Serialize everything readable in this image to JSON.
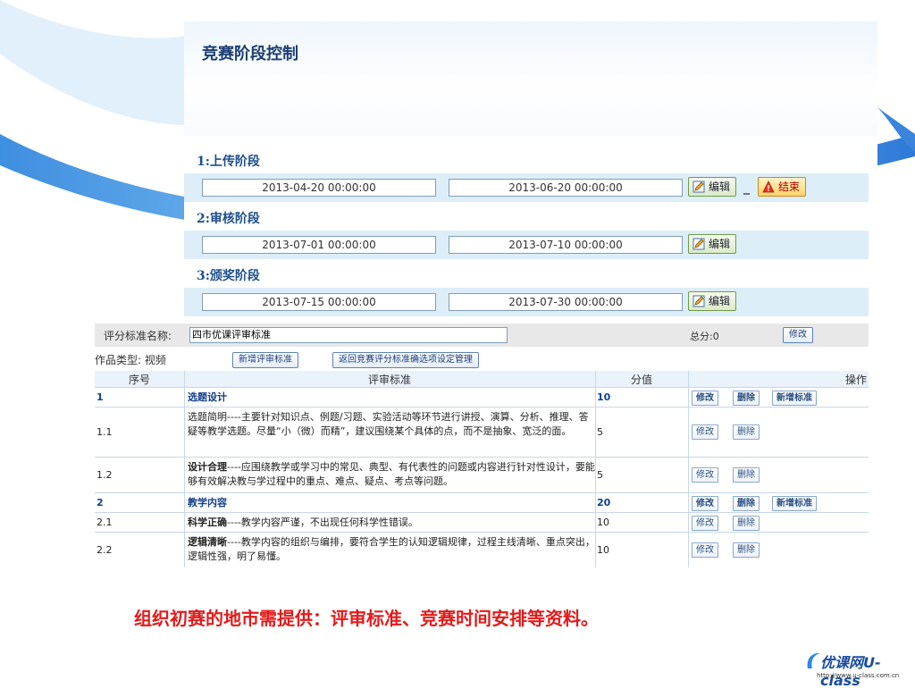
{
  "panel": {
    "title": "竞赛阶段控制",
    "stages": [
      {
        "label": "1:上传阶段",
        "start": "2013-04-20 00:00:00",
        "end": "2013-06-20 00:00:00",
        "edit": "编辑",
        "end_btn": "结束",
        "dash": "_"
      },
      {
        "label": "2:审核阶段",
        "start": "2013-07-01 00:00:00",
        "end": "2013-07-10 00:00:00",
        "edit": "编辑"
      },
      {
        "label": "3:颁奖阶段",
        "start": "2013-07-15 00:00:00",
        "end": "2013-07-30 00:00:00",
        "edit": "编辑"
      }
    ]
  },
  "standard": {
    "name_label": "评分标准名称:",
    "name_value": "四市优课评审标准",
    "total_label": "总分:0",
    "modify_btn": "修改",
    "type_label": "作品类型: 视频",
    "new_btn": "新增评审标准",
    "back_btn": "返回竞赛评分标准确选项设定管理"
  },
  "table": {
    "headers": {
      "no": "序号",
      "std": "评审标准",
      "val": "分值",
      "op": "操作"
    },
    "rows": [
      {
        "no": "1",
        "std_bold": "选题设计",
        "std": "",
        "val": "10",
        "cat": true
      },
      {
        "no": "1.1",
        "std_bold": "",
        "std": "选题简明----主要针对知识点、例题/习题、实验活动等环节进行讲授、演算、分析、推理、答疑等教学选题。尽量“小（微）而精”，建议围绕某个具体的点，而不是抽象、宽泛的面。",
        "val": "5",
        "cat": false
      },
      {
        "no": "1.2",
        "std_bold": "设计合理",
        "std": "----应围绕教学或学习中的常见、典型、有代表性的问题或内容进行针对性设计，要能够有效解决教与学过程中的重点、难点、疑点、考点等问题。",
        "val": "5",
        "cat": false
      },
      {
        "no": "2",
        "std_bold": "教学内容",
        "std": "",
        "val": "20",
        "cat": true
      },
      {
        "no": "2.1",
        "std_bold": "科学正确",
        "std": "----教学内容严谨，不出现任何科学性错误。",
        "val": "10",
        "cat": false
      },
      {
        "no": "2.2",
        "std_bold": "逻辑清晰",
        "std": "----教学内容的组织与编排，要符合学生的认知逻辑规律，过程主线清晰、重点突出，逻辑性强，明了易懂。",
        "val": "10",
        "cat": false
      }
    ],
    "op_modify": "修改",
    "op_delete": "删除",
    "op_new": "新增标准"
  },
  "caption": "组织初赛的地市需提供：评审标准、竞赛时间安排等资料。",
  "logo": {
    "main": "优课网U-class",
    "sub": "http://www.u-class.com.cn"
  }
}
